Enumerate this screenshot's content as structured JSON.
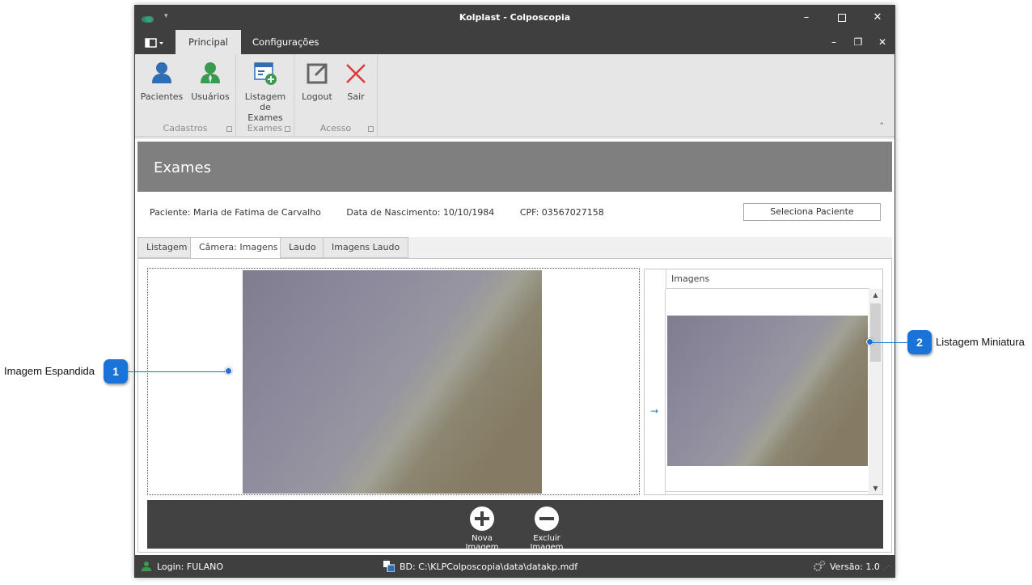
{
  "window": {
    "title": "Kolplast - Colposcopia"
  },
  "ribbon": {
    "tabs": [
      {
        "label": "Principal",
        "active": true
      },
      {
        "label": "Configurações",
        "active": false
      }
    ],
    "groups": [
      {
        "label": "Cadastros",
        "buttons": [
          {
            "label": "Pacientes",
            "icon": "person-icon"
          },
          {
            "label": "Usuários",
            "icon": "user-icon"
          }
        ]
      },
      {
        "label": "Exames",
        "buttons": [
          {
            "label": "Listagem de Exames",
            "icon": "list-add-icon"
          }
        ]
      },
      {
        "label": "Acesso",
        "buttons": [
          {
            "label": "Logout",
            "icon": "logout-icon"
          },
          {
            "label": "Sair",
            "icon": "close-icon"
          }
        ]
      }
    ]
  },
  "page": {
    "header": "Exames",
    "patient": "Paciente: Maria de Fatima de Carvalho",
    "birth": "Data de Nascimento: 10/10/1984",
    "cpf": "CPF: 03567027158",
    "select_button": "Seleciona Paciente",
    "tabs": [
      {
        "label": "Listagem",
        "active": false
      },
      {
        "label": "Câmera: Imagens",
        "active": true
      },
      {
        "label": "Laudo",
        "active": false
      },
      {
        "label": "Imagens Laudo",
        "active": false
      }
    ],
    "thumbs_header": "Imagens",
    "toolbar": {
      "new_image": "Nova Imagem",
      "delete_image": "Excluir Imagem"
    }
  },
  "status": {
    "login": "Login: FULANO",
    "db": "BD: C:\\KLPColposcopia\\data\\datakp.mdf",
    "version": "Versão: 1.0"
  },
  "callouts": [
    {
      "number": "1",
      "label": "Imagem Espandida"
    },
    {
      "number": "2",
      "label": "Listagem Miniatura"
    }
  ],
  "colors": {
    "accent": "#1a73d9",
    "titlebar": "#3f3f3f",
    "header": "#7f7f7f",
    "person_blue": "#2f6db5",
    "user_green": "#3a9a4e",
    "close_red": "#e03a3a"
  }
}
